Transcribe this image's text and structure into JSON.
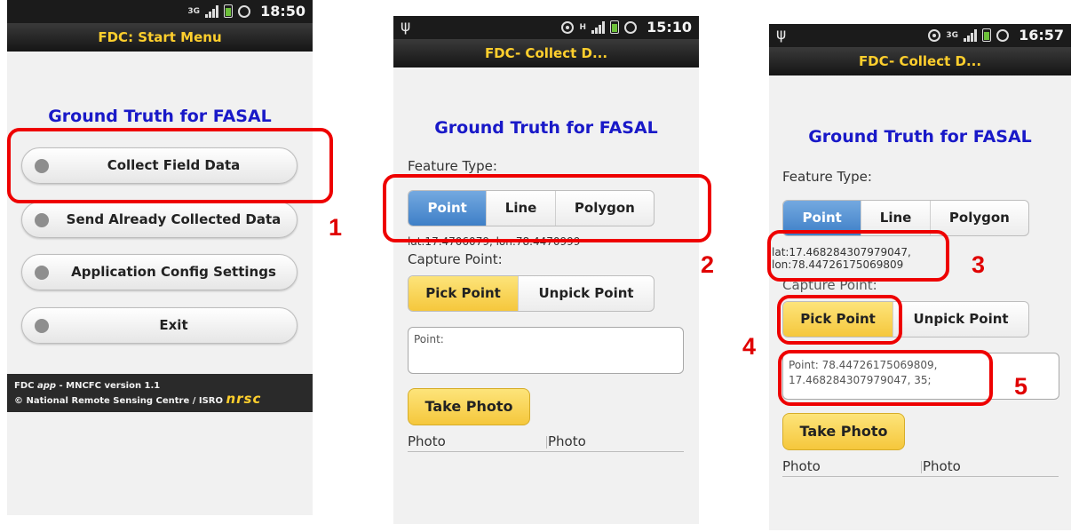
{
  "screen1": {
    "status_time": "18:50",
    "net_type": "3G",
    "title": "FDC: Start Menu",
    "heading": "Ground Truth for FASAL",
    "menu": [
      "Collect Field Data",
      "Send Already Collected Data",
      "Application Config Settings",
      "Exit"
    ],
    "footer_prefix": "FDC ",
    "footer_app": "app",
    "footer_version": " - MNCFC version 1.1",
    "footer_copyright": "© National Remote Sensing Centre / ISRO",
    "footer_logo": "nrsc"
  },
  "screen2": {
    "status_usb": "ψ",
    "status_time": "15:10",
    "net_type": "H",
    "title": "FDC- Collect D...",
    "heading": "Ground Truth for FASAL",
    "feature_label": "Feature Type:",
    "feature_options": [
      "Point",
      "Line",
      "Polygon"
    ],
    "coords_text": "lat:17.4706079, lon:78.4470999",
    "capture_label": "Capture Point:",
    "capture_options": [
      "Pick Point",
      "Unpick Point"
    ],
    "point_text": "Point:",
    "take_photo": "Take Photo",
    "photo_cols": [
      "Photo",
      "Photo"
    ]
  },
  "screen3": {
    "status_usb": "ψ",
    "status_time": "16:57",
    "net_type": "3G",
    "title": "FDC- Collect D...",
    "heading": "Ground Truth for FASAL",
    "feature_label": "Feature Type:",
    "feature_options": [
      "Point",
      "Line",
      "Polygon"
    ],
    "lat_text": "lat:17.468284307979047,",
    "lon_text": "lon:78.44726175069809",
    "capture_label": "Capture Point:",
    "capture_options": [
      "Pick Point",
      "Unpick Point"
    ],
    "point_line1": "Point: 78.44726175069809,",
    "point_line2": "17.468284307979047, 35;",
    "take_photo": "Take Photo",
    "photo_cols": [
      "Photo",
      "Photo"
    ]
  },
  "step_numbers": [
    "1",
    "2",
    "3",
    "4",
    "5"
  ],
  "colors": {
    "highlight": "#ee0000",
    "heading_blue": "#1919c8",
    "title_yellow": "#ffcf2d",
    "selected_blue": "#3e7fc7",
    "selected_yellow": "#f5c73c"
  },
  "icons": [
    "usb-icon",
    "gps-icon",
    "network-icon",
    "signal-icon",
    "battery-icon",
    "alarm-icon"
  ]
}
